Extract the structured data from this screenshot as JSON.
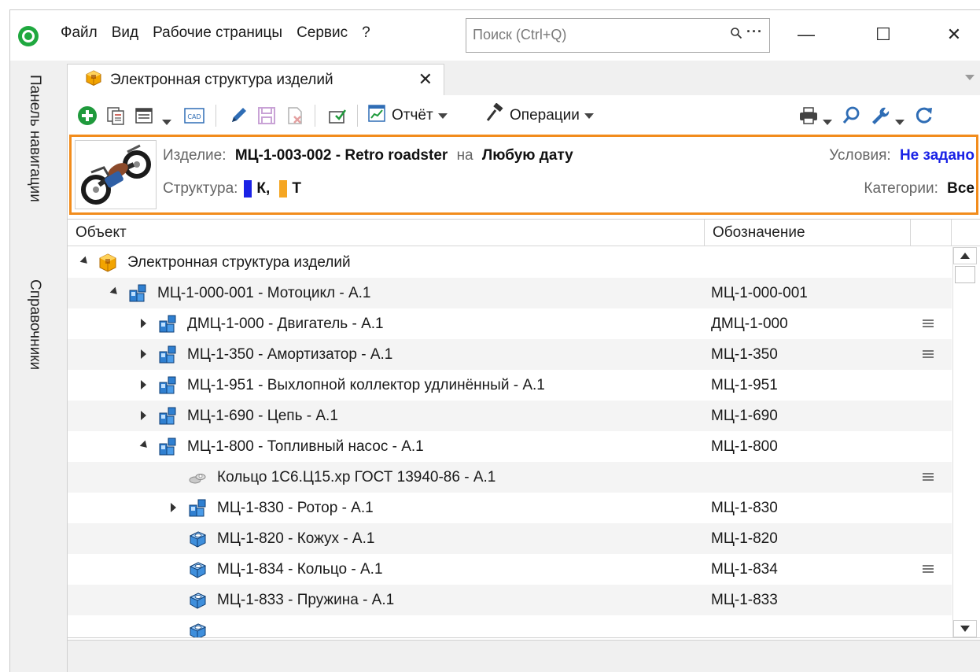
{
  "menu": {
    "items": [
      "Файл",
      "Вид",
      "Рабочие страницы",
      "Сервис",
      "?"
    ]
  },
  "search": {
    "placeholder": "Поиск (Ctrl+Q)",
    "more": "···"
  },
  "window_controls": {
    "minimize": "—",
    "maximize": "☐",
    "close": "✕"
  },
  "left_nav": {
    "panels": [
      "Панель навигации",
      "Справочники"
    ]
  },
  "document_tab": {
    "label": "Электронная структура изделий",
    "close": "✕"
  },
  "toolbar": {
    "report_label": "Отчёт",
    "operations_label": "Операции"
  },
  "header": {
    "product_label": "Изделие:",
    "product_value": "МЦ-1-003-002 - Retro roadster",
    "date_prefix": "на",
    "date_value": "Любую дату",
    "structure_label": "Структура:",
    "structure_items": [
      {
        "label": "К,",
        "color": "#1a22e6"
      },
      {
        "label": "Т",
        "color": "#f5a623"
      }
    ],
    "conditions_label": "Условия:",
    "conditions_value": "Не задано",
    "categories_label": "Категории:",
    "categories_value": "Все"
  },
  "grid": {
    "columns": [
      "Объект",
      "Обозначение"
    ],
    "rows": [
      {
        "depth": 0,
        "expander": "open",
        "icon": "structure-cube-icon",
        "name": "Электронная структура изделий",
        "code": "",
        "menu": false
      },
      {
        "depth": 1,
        "expander": "open",
        "icon": "assembly-icon",
        "name": "МЦ-1-000-001 - Мотоцикл - А.1",
        "code": "МЦ-1-000-001",
        "menu": false
      },
      {
        "depth": 2,
        "expander": "closed",
        "icon": "assembly-icon",
        "name": "ДМЦ-1-000 - Двигатель - А.1",
        "code": "ДМЦ-1-000",
        "menu": true
      },
      {
        "depth": 2,
        "expander": "closed",
        "icon": "assembly-icon",
        "name": "МЦ-1-350  - Амортизатор - А.1",
        "code": "МЦ-1-350",
        "menu": true
      },
      {
        "depth": 2,
        "expander": "closed",
        "icon": "assembly-icon",
        "name": "МЦ-1-951 - Выхлопной коллектор удлинённый - А.1",
        "code": "МЦ-1-951",
        "menu": false
      },
      {
        "depth": 2,
        "expander": "closed",
        "icon": "assembly-icon",
        "name": "МЦ-1-690 - Цепь - А.1",
        "code": "МЦ-1-690",
        "menu": false
      },
      {
        "depth": 2,
        "expander": "open",
        "icon": "assembly-icon",
        "name": "МЦ-1-800 - Топливный насос - А.1",
        "code": "МЦ-1-800",
        "menu": false
      },
      {
        "depth": 3,
        "expander": "none",
        "icon": "standard-part-icon",
        "name": "Кольцо 1С6.Ц15.хр ГОСТ 13940-86 - А.1",
        "code": "",
        "menu": true
      },
      {
        "depth": 3,
        "expander": "closed",
        "icon": "assembly-icon",
        "name": "МЦ-1-830  - Ротор - А.1",
        "code": "МЦ-1-830",
        "menu": false
      },
      {
        "depth": 3,
        "expander": "none",
        "icon": "part-icon",
        "name": "МЦ-1-820 - Кожух - А.1",
        "code": "МЦ-1-820",
        "menu": false
      },
      {
        "depth": 3,
        "expander": "none",
        "icon": "part-icon",
        "name": "МЦ-1-834  - Кольцо - А.1",
        "code": "МЦ-1-834",
        "menu": true
      },
      {
        "depth": 3,
        "expander": "none",
        "icon": "part-icon",
        "name": "МЦ-1-833 - Пружина - А.1",
        "code": "МЦ-1-833",
        "menu": false
      },
      {
        "depth": 3,
        "expander": "none",
        "icon": "part-icon",
        "name": "",
        "code": "",
        "menu": false
      }
    ]
  },
  "colors": {
    "accent_orange": "#f28c1c",
    "link_blue": "#1a22e6",
    "app_green": "#1fa83f"
  }
}
